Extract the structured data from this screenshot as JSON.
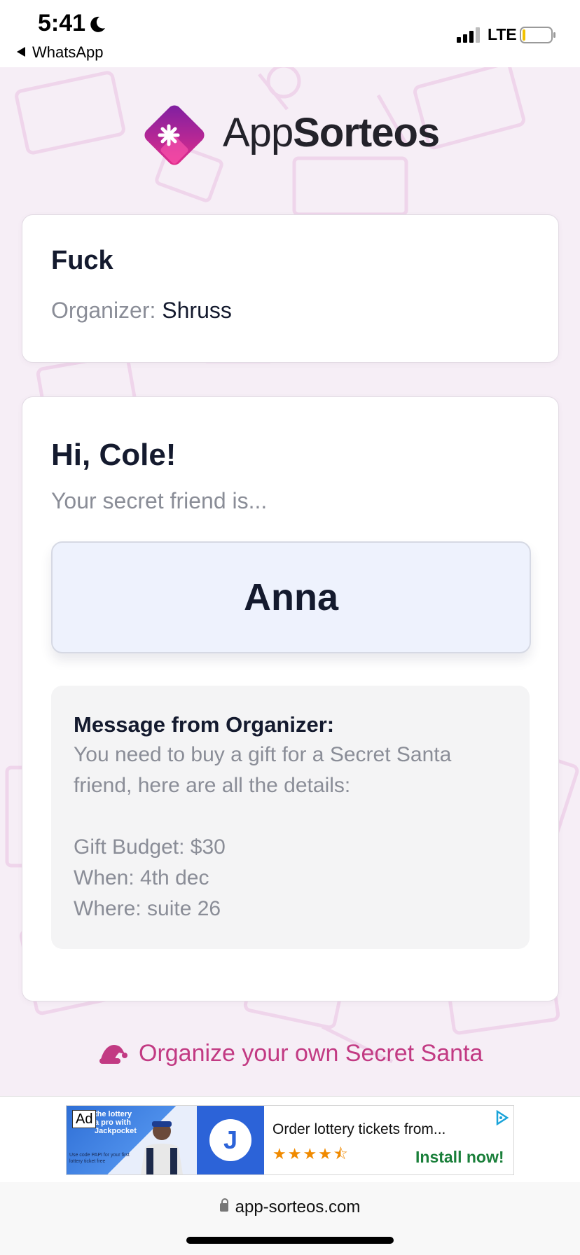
{
  "status_bar": {
    "time": "5:41",
    "back_app": "WhatsApp",
    "network": "LTE"
  },
  "brand": {
    "name_light": "App",
    "name_bold": "Sorteos",
    "accent_color": "#c23a83"
  },
  "draw_card": {
    "title": "Fuck",
    "organizer_label": "Organizer:",
    "organizer_name": "Shruss"
  },
  "result_card": {
    "greeting": "Hi, Cole!",
    "subtitle": "Your secret friend is...",
    "secret_friend": "Anna",
    "message_heading": "Message from Organizer:",
    "message_lines": [
      "You need to buy a gift for a Secret Santa",
      "friend, here are all the details:",
      "",
      "Gift Budget: $30",
      "When: 4th dec",
      "Where: suite 26"
    ]
  },
  "cta": {
    "icon": "santa-hat-icon",
    "label": "Organize your own Secret Santa"
  },
  "ad": {
    "badge": "Ad",
    "logo_letter": "J",
    "image_text_top": "the lottery\na pro with\nJackpocket",
    "image_text_bottom": "Use code PAPI for your first lottery ticket free",
    "title": "Order lottery tickets from...",
    "rating": 4.5,
    "stars": "★★★★⯪",
    "cta": "Install now!"
  },
  "url_bar": {
    "url": "app-sorteos.com"
  }
}
